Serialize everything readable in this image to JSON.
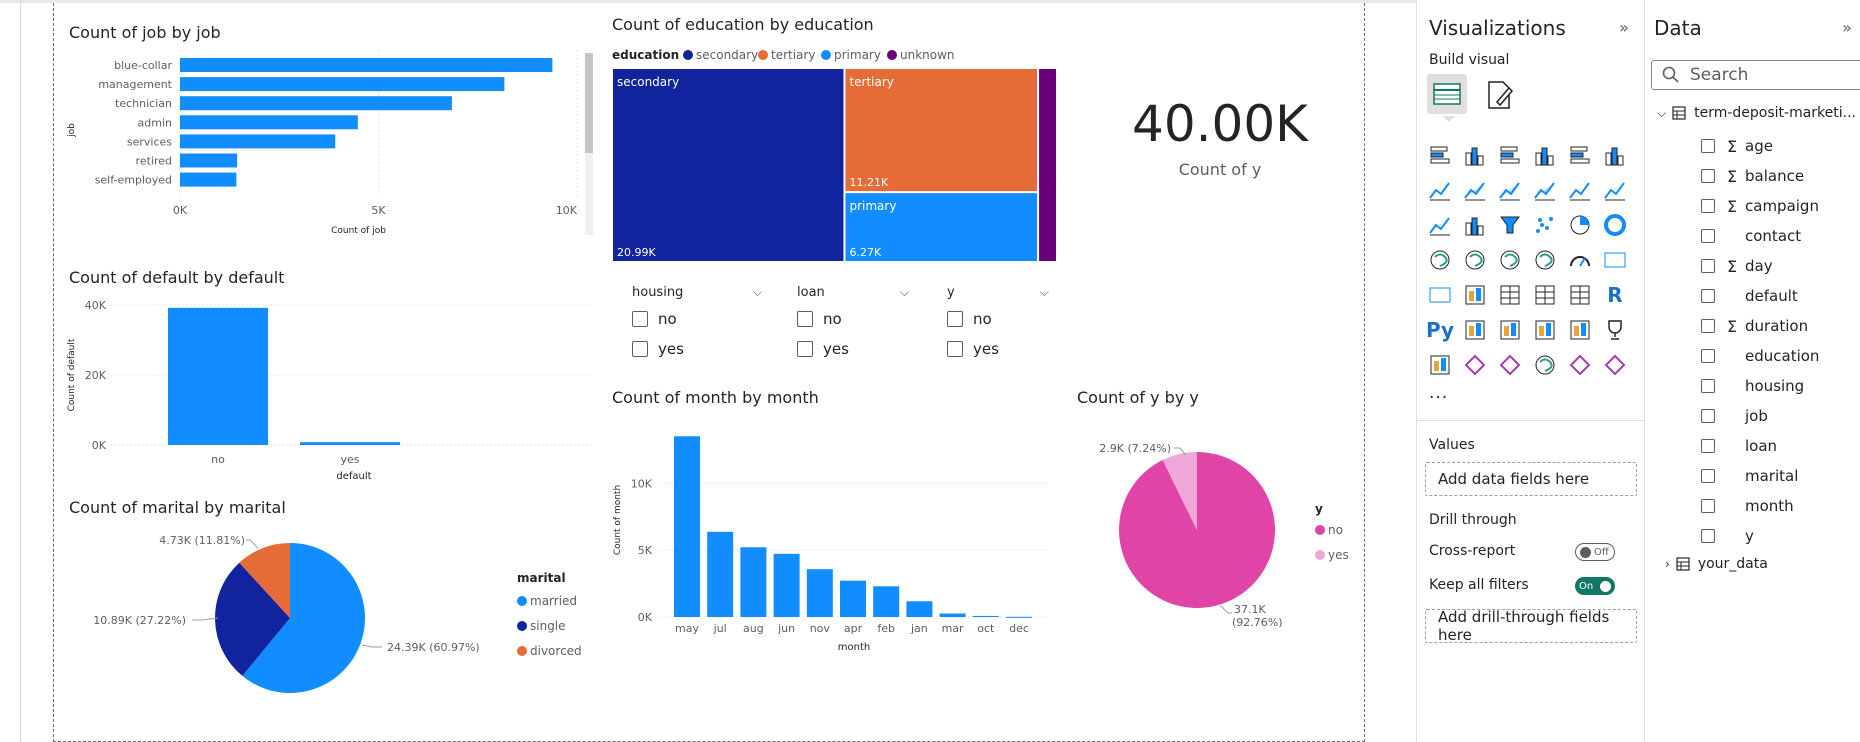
{
  "charts": {
    "job": {
      "title": "Count of job by job",
      "xlabel": "Count of job",
      "ylabel": "job",
      "ticks": [
        "0K",
        "5K",
        "10K"
      ]
    },
    "default": {
      "title": "Count of default by default",
      "xlabel": "default",
      "ylabel": "Count of default",
      "ticks": [
        "0K",
        "20K",
        "40K"
      ]
    },
    "marital": {
      "title": "Count of marital by marital",
      "legend_title": "marital",
      "labels": [
        "24.39K (60.97%)",
        "10.89K (27.22%)",
        "4.73K (11.81%)"
      ]
    },
    "education": {
      "title": "Count of education by education",
      "legend_title": "education",
      "tile_labels": {
        "secondary": "secondary",
        "secondary_value": "20.99K",
        "tertiary": "tertiary",
        "tertiary_value": "11.21K",
        "primary": "primary",
        "primary_value": "6.27K"
      }
    },
    "month": {
      "title": "Count of month by month",
      "xlabel": "month",
      "ylabel": "Count of month",
      "ticks": [
        "0K",
        "5K",
        "10K"
      ]
    },
    "y": {
      "title": "Count of y by y",
      "legend_title": "y",
      "labels": [
        "2.9K (7.24%)",
        "37.1K",
        "(92.76%)"
      ]
    },
    "card": {
      "value": "40.00K",
      "label": "Count of y"
    }
  },
  "chart_data": [
    {
      "type": "bar",
      "orientation": "horizontal",
      "title": "Count of job by job",
      "categories": [
        "blue-collar",
        "management",
        "technician",
        "admin",
        "services",
        "retired",
        "self-employed"
      ],
      "values": [
        9380,
        8170,
        6850,
        4480,
        3910,
        1440,
        1420
      ],
      "xlim": [
        0,
        10000
      ],
      "xlabel": "Count of job",
      "ylabel": "job",
      "grid": true
    },
    {
      "type": "bar",
      "title": "Count of default by default",
      "categories": [
        "no",
        "yes"
      ],
      "values": [
        39190,
        810
      ],
      "ylim": [
        0,
        40000
      ],
      "xlabel": "default",
      "ylabel": "Count of default",
      "grid": true
    },
    {
      "type": "pie",
      "title": "Count of marital by marital",
      "categories": [
        "married",
        "single",
        "divorced"
      ],
      "values": [
        24390,
        10890,
        4730
      ],
      "percent": [
        60.97,
        27.22,
        11.81
      ],
      "legend": "right"
    },
    {
      "type": "treemap",
      "title": "Count of education by education",
      "categories": [
        "secondary",
        "tertiary",
        "primary",
        "unknown"
      ],
      "values": [
        20990,
        11210,
        6270,
        1530
      ],
      "legend": "top"
    },
    {
      "type": "bar",
      "title": "Count of month by month",
      "categories": [
        "may",
        "jul",
        "aug",
        "jun",
        "nov",
        "apr",
        "feb",
        "jan",
        "mar",
        "oct",
        "dec"
      ],
      "values": [
        13530,
        6380,
        5220,
        4730,
        3580,
        2720,
        2300,
        1180,
        260,
        80,
        13
      ],
      "ylim": [
        0,
        14000
      ],
      "xlabel": "month",
      "ylabel": "Count of month",
      "grid": true
    },
    {
      "type": "pie",
      "title": "Count of y by y",
      "categories": [
        "no",
        "yes"
      ],
      "values": [
        37100,
        2900
      ],
      "percent": [
        92.76,
        7.24
      ],
      "legend": "right"
    }
  ],
  "slicers": [
    {
      "title": "housing",
      "options": [
        "no",
        "yes"
      ]
    },
    {
      "title": "loan",
      "options": [
        "no",
        "yes"
      ]
    },
    {
      "title": "y",
      "options": [
        "no",
        "yes"
      ]
    }
  ],
  "colors": {
    "blue": "#118dff",
    "navy": "#12239e",
    "orange": "#e66c37",
    "purple": "#6b007b",
    "pink": "#e044a7",
    "light_pink": "#f0a8d8",
    "toggle_on": "#117865"
  },
  "visualizations_pane": {
    "title": "Visualizations",
    "build_visual": "Build visual",
    "values_label": "Values",
    "values_well": "Add data fields here",
    "drill_through": "Drill through",
    "cross_report": "Cross-report",
    "cross_report_state": "Off",
    "keep_all_filters": "Keep all filters",
    "keep_all_filters_state": "On",
    "drill_well": "Add drill-through fields here",
    "more": "···",
    "py_label": "Py",
    "r_label": "R"
  },
  "data_pane": {
    "title": "Data",
    "search_placeholder": "Search",
    "table_name": "term-deposit-marketi...",
    "fields": [
      {
        "name": "age",
        "sigma": true
      },
      {
        "name": "balance",
        "sigma": true
      },
      {
        "name": "campaign",
        "sigma": true
      },
      {
        "name": "contact",
        "sigma": false
      },
      {
        "name": "day",
        "sigma": true
      },
      {
        "name": "default",
        "sigma": false
      },
      {
        "name": "duration",
        "sigma": true
      },
      {
        "name": "education",
        "sigma": false
      },
      {
        "name": "housing",
        "sigma": false
      },
      {
        "name": "job",
        "sigma": false
      },
      {
        "name": "loan",
        "sigma": false
      },
      {
        "name": "marital",
        "sigma": false
      },
      {
        "name": "month",
        "sigma": false
      },
      {
        "name": "y",
        "sigma": false
      }
    ],
    "other_table": "your_data"
  }
}
